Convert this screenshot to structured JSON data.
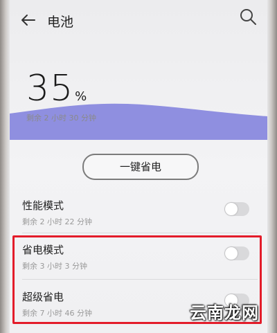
{
  "header": {
    "title": "电池"
  },
  "battery": {
    "percent": "35",
    "percent_unit": "%",
    "remaining": "剩余 2 小时 30 分钟"
  },
  "one_key_button": "一键省电",
  "modes": [
    {
      "title": "性能模式",
      "subtitle": "剩余 2 小时 22 分钟",
      "enabled": false
    },
    {
      "title": "省电模式",
      "subtitle": "剩余 3 小时 3 分钟",
      "enabled": false
    },
    {
      "title": "超级省电",
      "subtitle": "剩余 7 小时 46 分钟",
      "enabled": false
    }
  ],
  "watermark": "云南龙网",
  "colors": {
    "wave": "#8f8fe0",
    "highlight": "#e31c2a"
  },
  "icons": [
    "back-arrow-icon",
    "search-icon"
  ]
}
